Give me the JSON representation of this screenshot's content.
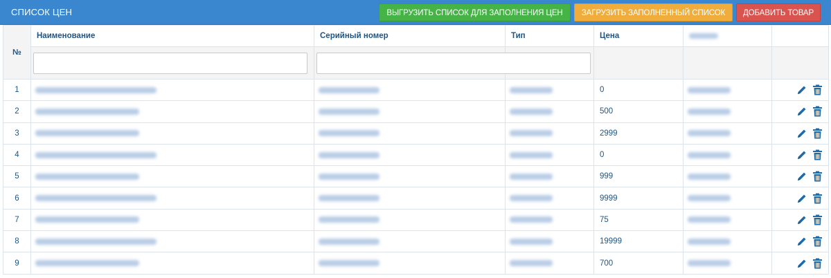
{
  "header": {
    "title": "СПИСОК ЦЕН",
    "buttons": {
      "export": "ВЫГРУЗИТЬ СПИСОК ДЛЯ ЗАПОЛНЕНИЯ ЦЕН",
      "import": "ЗАГРУЗИТЬ ЗАПОЛНЕННЫЙ СПИСОК",
      "add": "ДОБАВИТЬ ТОВАР"
    },
    "colors": {
      "header_bg": "#3b87cf",
      "export": "#46b346",
      "import": "#f0ad3c",
      "add": "#d9534f"
    }
  },
  "table": {
    "columns": {
      "num": "№",
      "name": "Наименование",
      "serial": "Серийный номер",
      "type": "Тип",
      "price": "Цена"
    },
    "filters": {
      "name_value": "",
      "serial_value": ""
    },
    "rows": [
      {
        "num": "1",
        "price": "0"
      },
      {
        "num": "2",
        "price": "500"
      },
      {
        "num": "3",
        "price": "2999"
      },
      {
        "num": "4",
        "price": "0"
      },
      {
        "num": "5",
        "price": "999"
      },
      {
        "num": "6",
        "price": "9999"
      },
      {
        "num": "7",
        "price": "75"
      },
      {
        "num": "8",
        "price": "19999"
      },
      {
        "num": "9",
        "price": "700"
      }
    ],
    "row_icons": [
      "pencil-icon",
      "trash-icon"
    ]
  }
}
